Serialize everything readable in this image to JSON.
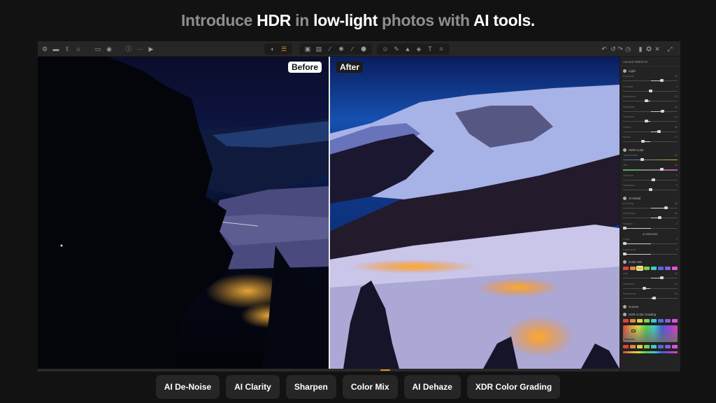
{
  "headline": [
    {
      "text": "Introduce ",
      "style": "dim"
    },
    {
      "text": "HDR",
      "style": "hi"
    },
    {
      "text": " in ",
      "style": "dim"
    },
    {
      "text": "low-light",
      "style": "hi"
    },
    {
      "text": " photos with ",
      "style": "dim"
    },
    {
      "text": "AI tools.",
      "style": "hi"
    }
  ],
  "toolbar": {
    "left_icons": [
      "settings-icon",
      "folder-icon",
      "export-icon",
      "share-icon",
      "calendar-icon",
      "compass-icon",
      "info-icon",
      "more-icon",
      "compare-icon"
    ],
    "center_group_1": [
      "mask-icon",
      "adjustments-icon"
    ],
    "center_group_2": [
      "crop-frame-icon",
      "image-frame-icon",
      "eyedropper-icon",
      "light-icon",
      "brush-icon",
      "3d-cube-icon"
    ],
    "center_group_3": [
      "face-icon",
      "healing-icon",
      "triangle-icon",
      "layers-icon",
      "text-icon",
      "transform-icon"
    ],
    "right_icons": [
      "undo-icon",
      "redo-back-icon",
      "redo-icon",
      "history-icon",
      "panel-icon",
      "badge-icon",
      "tools-icon",
      "expand-icon"
    ],
    "active_icon": "adjustments-icon"
  },
  "viewer": {
    "before_label": "Before",
    "after_label": "After",
    "split_fraction": 0.5
  },
  "panel": {
    "title": "ADJUSTMENTS",
    "sections": [
      {
        "name": "Light",
        "sliders": [
          {
            "label": "Exposure",
            "value": "33",
            "pos": 0.7
          },
          {
            "label": "Contrast",
            "value": "0",
            "pos": 0.5
          },
          {
            "label": "Brightness",
            "value": "-15",
            "pos": 0.42
          },
          {
            "label": "Highlights",
            "value": "44",
            "pos": 0.72
          },
          {
            "label": "Shadows",
            "value": "-14",
            "pos": 0.42
          },
          {
            "label": "Whites",
            "value": "30",
            "pos": 0.65
          },
          {
            "label": "Blacks",
            "value": "-27",
            "pos": 0.36
          }
        ]
      },
      {
        "name": "HDR Color",
        "sliders": [
          {
            "label": "Temperature",
            "value": "-33",
            "pos": 0.35,
            "track": "temp"
          },
          {
            "label": "Tint",
            "value": "40",
            "pos": 0.7,
            "track": "tint"
          },
          {
            "label": "Vibrance",
            "value": "0",
            "pos": 0.55
          },
          {
            "label": "Saturation",
            "value": "0",
            "pos": 0.5
          }
        ]
      },
      {
        "name": "AI Detail",
        "sliders": [
          {
            "label": "AI Clarity",
            "value": "55",
            "pos": 0.78
          },
          {
            "label": "AI Dehaze",
            "value": "40",
            "pos": 0.67
          },
          {
            "label": "Sharpen",
            "value": "0",
            "pos": 0.0
          }
        ]
      }
    ],
    "denoise": {
      "title": "AI DENOISE",
      "sliders": [
        {
          "label": "Color",
          "value": "0",
          "pos": 0.0
        },
        {
          "label": "Luminance",
          "value": "0",
          "pos": 0.0
        }
      ]
    },
    "color_mix": {
      "name": "Color Mix",
      "swatches": [
        "#d9443b",
        "#e38a3e",
        "#e0d23c",
        "#7fcf48",
        "#45c7c9",
        "#4a6ee0",
        "#8f5ae0",
        "#d55ad8"
      ],
      "selected": 2,
      "sliders": [
        {
          "label": "Hue",
          "value": "45",
          "pos": 0.7
        },
        {
          "label": "Saturation",
          "value": "-24",
          "pos": 0.38
        },
        {
          "label": "Luminance",
          "value": "15",
          "pos": 0.56
        }
      ]
    },
    "curves": {
      "name": "Curves"
    },
    "grading": {
      "name": "HDR Color Grading",
      "swatches": [
        "#d9443b",
        "#e38a3e",
        "#e0d23c",
        "#7fcf48",
        "#45c7c9",
        "#4a6ee0",
        "#8f5ae0",
        "#d55ad8"
      ],
      "wheel_label": "Shadows"
    }
  },
  "chips": [
    "AI De-Noise",
    "AI Clarity",
    "Sharpen",
    "Color Mix",
    "AI Dehaze",
    "XDR Color Grading"
  ]
}
